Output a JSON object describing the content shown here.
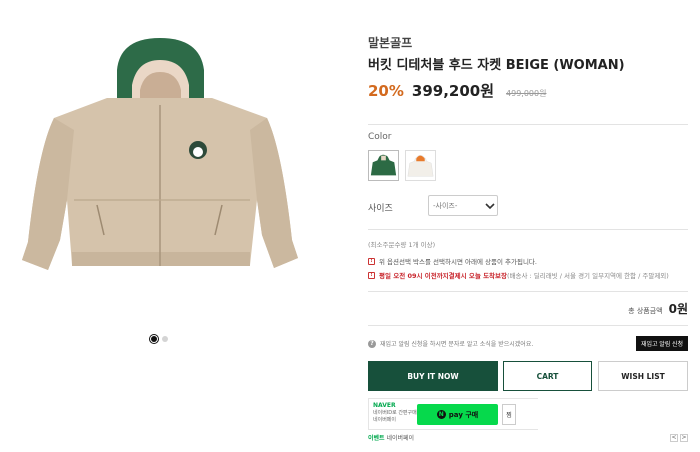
{
  "product": {
    "brand": "말본골프",
    "title": "버킷 디테처블 후드 자켓 BEIGE (WOMAN)",
    "discount": "20%",
    "price": "399,200원",
    "original_price": "499,000원"
  },
  "image": {
    "carousel_count": 2,
    "active_index": 1
  },
  "options": {
    "color_label": "Color",
    "colors": [
      {
        "name": "green-jacket-swatch",
        "hex": "#2c6a44"
      },
      {
        "name": "white-orange-jacket-swatch",
        "hex": "#f2f0ea"
      }
    ],
    "size_label": "사이즈",
    "size_placeholder": "-사이즈-"
  },
  "notes": {
    "min_order": "(최소주문수량 1개 이상)",
    "note1": "위 옵션선택 박스를 선택하시면 아래에 상품이 추가됩니다.",
    "note2_red": "평일 오전 09시 이전까지",
    "note2_red_suffix": " 결제시 오늘 도착보장",
    "note2_grey": " (배송사 : 딜리래빗 / 서울 경기 일부지역에 한함 / 주말제외)"
  },
  "total": {
    "label": "총 상품금액",
    "value": "0원"
  },
  "restock": {
    "info": "재입고 알림 신청을 하시면 문자로 알고 소식을 받으시겠어요.",
    "button": "재입고 알림 신청"
  },
  "buttons": {
    "buy_now": "BUY IT NOW",
    "cart": "CART",
    "wish_list": "WISH LIST"
  },
  "naver": {
    "logo": "NAVER",
    "desc_line1": "네이버ID로 간편구매",
    "desc_line2": "네이버페이",
    "pay_label": "pay 구매",
    "pay_n": "N",
    "jjim": "찜",
    "event_prefix": "이벤트",
    "event_text": " 네이버페이",
    "pager_prev": "<",
    "pager_next": ">"
  },
  "colors": {
    "accent_green": "#17503b",
    "discount_orange": "#d36a1f",
    "npay_green": "#06d94c"
  }
}
